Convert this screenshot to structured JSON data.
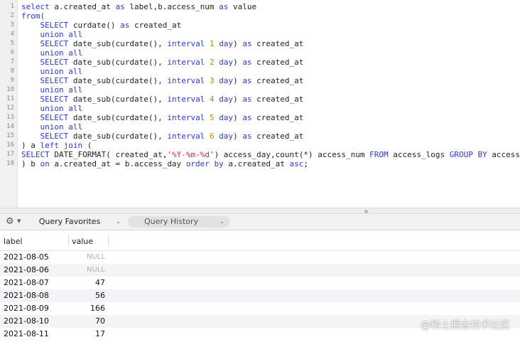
{
  "editor": {
    "lines": [
      {
        "n": "1",
        "parts": [
          {
            "t": "select",
            "k": "kw"
          },
          {
            "t": " a.created_at "
          },
          {
            "t": "as",
            "k": "kw"
          },
          {
            "t": " label,b.access_num "
          },
          {
            "t": "as",
            "k": "kw"
          },
          {
            "t": " value"
          }
        ]
      },
      {
        "n": "2",
        "parts": [
          {
            "t": "from(",
            "k": "kw"
          }
        ]
      },
      {
        "n": "3",
        "parts": [
          {
            "t": "    "
          },
          {
            "t": "SELECT",
            "k": "kw"
          },
          {
            "t": " curdate() "
          },
          {
            "t": "as",
            "k": "kw"
          },
          {
            "t": " created_at"
          }
        ]
      },
      {
        "n": "4",
        "parts": [
          {
            "t": "    "
          },
          {
            "t": "union all",
            "k": "kw"
          }
        ]
      },
      {
        "n": "5",
        "parts": [
          {
            "t": "    "
          },
          {
            "t": "SELECT",
            "k": "kw"
          },
          {
            "t": " date_sub(curdate(), "
          },
          {
            "t": "interval",
            "k": "kw"
          },
          {
            "t": " "
          },
          {
            "t": "1",
            "k": "num"
          },
          {
            "t": " "
          },
          {
            "t": "day",
            "k": "kw"
          },
          {
            "t": ") "
          },
          {
            "t": "as",
            "k": "kw"
          },
          {
            "t": " created_at"
          }
        ]
      },
      {
        "n": "6",
        "parts": [
          {
            "t": "    "
          },
          {
            "t": "union all",
            "k": "kw"
          }
        ]
      },
      {
        "n": "7",
        "parts": [
          {
            "t": "    "
          },
          {
            "t": "SELECT",
            "k": "kw"
          },
          {
            "t": " date_sub(curdate(), "
          },
          {
            "t": "interval",
            "k": "kw"
          },
          {
            "t": " "
          },
          {
            "t": "2",
            "k": "num"
          },
          {
            "t": " "
          },
          {
            "t": "day",
            "k": "kw"
          },
          {
            "t": ") "
          },
          {
            "t": "as",
            "k": "kw"
          },
          {
            "t": " created_at"
          }
        ]
      },
      {
        "n": "8",
        "parts": [
          {
            "t": "    "
          },
          {
            "t": "union all",
            "k": "kw"
          }
        ]
      },
      {
        "n": "9",
        "parts": [
          {
            "t": "    "
          },
          {
            "t": "SELECT",
            "k": "kw"
          },
          {
            "t": " date_sub(curdate(), "
          },
          {
            "t": "interval",
            "k": "kw"
          },
          {
            "t": " "
          },
          {
            "t": "3",
            "k": "num"
          },
          {
            "t": " "
          },
          {
            "t": "day",
            "k": "kw"
          },
          {
            "t": ") "
          },
          {
            "t": "as",
            "k": "kw"
          },
          {
            "t": " created_at"
          }
        ]
      },
      {
        "n": "10",
        "parts": [
          {
            "t": "    "
          },
          {
            "t": "union all",
            "k": "kw"
          }
        ]
      },
      {
        "n": "11",
        "parts": [
          {
            "t": "    "
          },
          {
            "t": "SELECT",
            "k": "kw"
          },
          {
            "t": " date_sub(curdate(), "
          },
          {
            "t": "interval",
            "k": "kw"
          },
          {
            "t": " "
          },
          {
            "t": "4",
            "k": "num"
          },
          {
            "t": " "
          },
          {
            "t": "day",
            "k": "kw"
          },
          {
            "t": ") "
          },
          {
            "t": "as",
            "k": "kw"
          },
          {
            "t": " created_at"
          }
        ]
      },
      {
        "n": "12",
        "parts": [
          {
            "t": "    "
          },
          {
            "t": "union all",
            "k": "kw"
          }
        ]
      },
      {
        "n": "13",
        "parts": [
          {
            "t": "    "
          },
          {
            "t": "SELECT",
            "k": "kw"
          },
          {
            "t": " date_sub(curdate(), "
          },
          {
            "t": "interval",
            "k": "kw"
          },
          {
            "t": " "
          },
          {
            "t": "5",
            "k": "num"
          },
          {
            "t": " "
          },
          {
            "t": "day",
            "k": "kw"
          },
          {
            "t": ") "
          },
          {
            "t": "as",
            "k": "kw"
          },
          {
            "t": " created_at"
          }
        ]
      },
      {
        "n": "14",
        "parts": [
          {
            "t": "    "
          },
          {
            "t": "union all",
            "k": "kw"
          }
        ]
      },
      {
        "n": "15",
        "parts": [
          {
            "t": "    "
          },
          {
            "t": "SELECT",
            "k": "kw"
          },
          {
            "t": " date_sub(curdate(), "
          },
          {
            "t": "interval",
            "k": "kw"
          },
          {
            "t": " "
          },
          {
            "t": "6",
            "k": "num"
          },
          {
            "t": " "
          },
          {
            "t": "day",
            "k": "kw"
          },
          {
            "t": ") "
          },
          {
            "t": "as",
            "k": "kw"
          },
          {
            "t": " created_at"
          }
        ]
      },
      {
        "n": "16",
        "parts": [
          {
            "t": ") a "
          },
          {
            "t": "left join",
            "k": "kw"
          },
          {
            "t": " ("
          }
        ]
      },
      {
        "n": "17",
        "parts": [
          {
            "t": "SELECT",
            "k": "kw"
          },
          {
            "t": " DATE_FORMAT( created_at,"
          },
          {
            "t": "'%Y-%m-%d'",
            "k": "str"
          },
          {
            "t": ") access_day,count(*) access_num "
          },
          {
            "t": "FROM",
            "k": "kw"
          },
          {
            "t": " access_logs "
          },
          {
            "t": "GROUP BY",
            "k": "kw"
          },
          {
            "t": " access_day"
          }
        ]
      },
      {
        "n": "18",
        "parts": [
          {
            "t": ") b "
          },
          {
            "t": "on",
            "k": "kw"
          },
          {
            "t": " a.created_at = b.access_day "
          },
          {
            "t": "order by",
            "k": "kw"
          },
          {
            "t": " a.created_at "
          },
          {
            "t": "asc",
            "k": "kw"
          },
          {
            "t": ";"
          }
        ]
      }
    ]
  },
  "toolbar": {
    "gear_icon": "gear-icon",
    "favorites_label": "Query Favorites",
    "history_label": "Query History"
  },
  "results": {
    "columns": [
      "label",
      "value"
    ],
    "rows": [
      {
        "label": "2021-08-05",
        "value": "NULL"
      },
      {
        "label": "2021-08-06",
        "value": "NULL"
      },
      {
        "label": "2021-08-07",
        "value": "47"
      },
      {
        "label": "2021-08-08",
        "value": "56"
      },
      {
        "label": "2021-08-09",
        "value": "166"
      },
      {
        "label": "2021-08-10",
        "value": "70"
      },
      {
        "label": "2021-08-11",
        "value": "17"
      }
    ]
  },
  "watermark": "@稀土掘金技术社区",
  "colors": {
    "keyword": "#2e39c5",
    "number": "#b58900",
    "string": "#c7254e",
    "null": "#b0b0b0"
  }
}
